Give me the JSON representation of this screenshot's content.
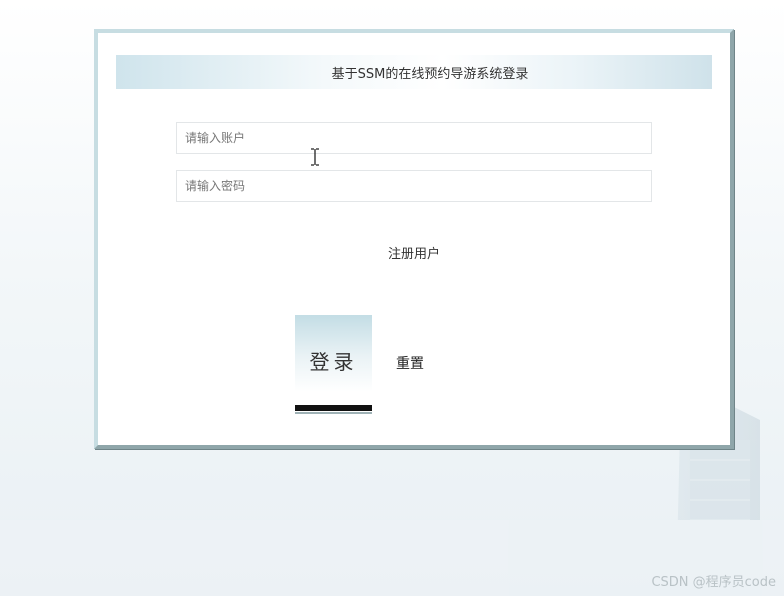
{
  "login": {
    "title": "基于SSM的在线预约导游系统登录",
    "account_placeholder": "请输入账户",
    "password_placeholder": "请输入密码",
    "register_label": "注册用户",
    "login_label": "登录",
    "reset_label": "重置"
  },
  "watermark": "CSDN @程序员code",
  "colors": {
    "page_background": "#f3f7f9",
    "card_border_light": "#c7dde2",
    "card_border_dark": "#8fa6aa",
    "title_gradient_edge": "#cfe4ec",
    "login_button_top": "#c3dde5"
  },
  "icons": [
    "text-cursor-icon"
  ]
}
